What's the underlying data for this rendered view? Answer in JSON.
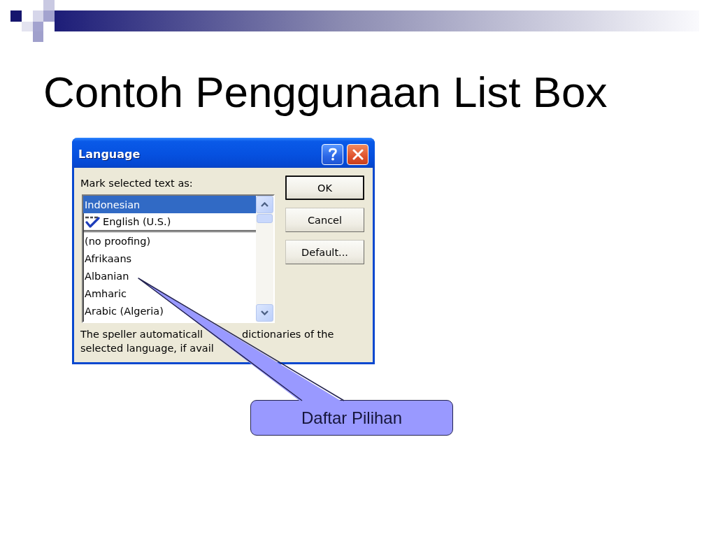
{
  "slide": {
    "title": "Contoh Penggunaan List Box"
  },
  "dialog": {
    "title": "Language",
    "label": "Mark selected text as:",
    "list": {
      "recent": [
        {
          "text": "Indonesian",
          "selected": true,
          "spell_check": false
        },
        {
          "text": "English (U.S.)",
          "selected": false,
          "spell_check": true
        }
      ],
      "items": [
        {
          "text": "(no proofing)",
          "selected": false,
          "spell_check": false
        },
        {
          "text": "Afrikaans",
          "selected": false,
          "spell_check": false
        },
        {
          "text": "Albanian",
          "selected": false,
          "spell_check": false
        },
        {
          "text": "Amharic",
          "selected": false,
          "spell_check": false
        },
        {
          "text": "Arabic (Algeria)",
          "selected": false,
          "spell_check": false
        }
      ]
    },
    "buttons": [
      {
        "label": "OK",
        "default": true
      },
      {
        "label": "Cancel",
        "default": false
      },
      {
        "label": "Default...",
        "default": false
      }
    ],
    "note_lines": [
      [
        "The speller automaticall",
        "dictionaries of the"
      ],
      [
        "selected language, if avail"
      ]
    ]
  },
  "callout": {
    "text": "Daftar Pilihan"
  }
}
